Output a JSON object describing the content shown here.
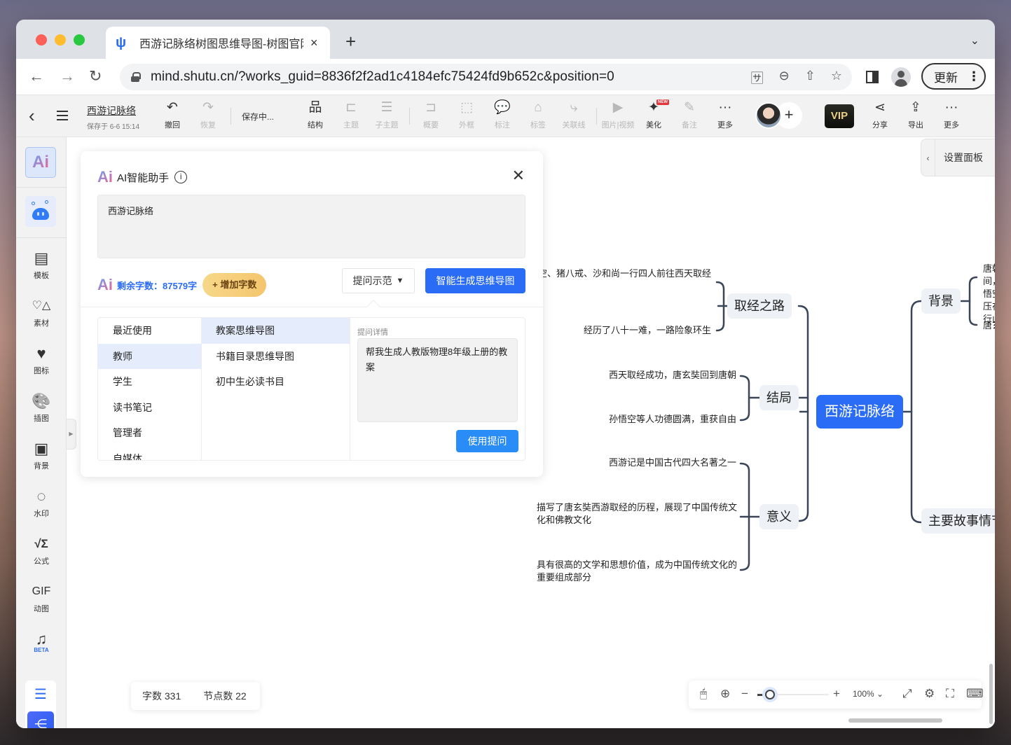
{
  "browser": {
    "tab_title": "西游记脉络树图思维导图-树图官网",
    "tab_favicon": "shutu-logo-icon",
    "new_tab": "+",
    "tab_close": "×",
    "url": "mind.shutu.cn/?works_guid=8836f2f2ad1c4184efc75424fd9b652c&position=0",
    "update_label": "更新",
    "nav": {
      "back": "←",
      "forward": "→",
      "reload": "↻"
    }
  },
  "toolbar": {
    "doc_title": "西游记脉络",
    "saved_at": "保存于 6-6 15:14",
    "saving_status": "保存中...",
    "tools": [
      {
        "id": "undo",
        "label": "撤回",
        "icon": "↶",
        "disabled": false
      },
      {
        "id": "redo",
        "label": "恢复",
        "icon": "↷",
        "disabled": true
      },
      {
        "id": "structure",
        "label": "结构",
        "icon": "品",
        "disabled": false
      },
      {
        "id": "topic",
        "label": "主题",
        "icon": "⊏",
        "disabled": true
      },
      {
        "id": "subtopic",
        "label": "子主题",
        "icon": "☰",
        "disabled": true
      },
      {
        "id": "summary",
        "label": "概要",
        "icon": "⊐",
        "disabled": true
      },
      {
        "id": "boundary",
        "label": "外框",
        "icon": "⬚",
        "disabled": true
      },
      {
        "id": "callout",
        "label": "标注",
        "icon": "💬",
        "disabled": true
      },
      {
        "id": "tag",
        "label": "标签",
        "icon": "⌂",
        "disabled": true
      },
      {
        "id": "relation",
        "label": "关联线",
        "icon": "⤷",
        "disabled": true
      },
      {
        "id": "media",
        "label": "图片|视频",
        "icon": "▶",
        "disabled": true
      },
      {
        "id": "beautify",
        "label": "美化",
        "icon": "✦",
        "disabled": false,
        "badge": "NEW"
      },
      {
        "id": "note",
        "label": "备注",
        "icon": "✎",
        "disabled": true
      },
      {
        "id": "more1",
        "label": "更多",
        "icon": "···",
        "disabled": false
      }
    ],
    "vip_label": "VIP",
    "right_tools": [
      {
        "id": "share",
        "label": "分享",
        "icon": "⋖"
      },
      {
        "id": "export",
        "label": "导出",
        "icon": "⇪"
      },
      {
        "id": "more2",
        "label": "更多",
        "icon": "···"
      }
    ],
    "add_collaborator": "+"
  },
  "sidebar": {
    "ai_label": "Ai",
    "items": [
      {
        "id": "template",
        "label": "模板",
        "icon": "▤"
      },
      {
        "id": "material",
        "label": "素材",
        "icon": "♡△"
      },
      {
        "id": "icon",
        "label": "图标",
        "icon": "♥"
      },
      {
        "id": "illustration",
        "label": "插图",
        "icon": "🎨"
      },
      {
        "id": "background",
        "label": "背景",
        "icon": "▣"
      },
      {
        "id": "watermark",
        "label": "水印",
        "icon": "◌"
      },
      {
        "id": "formula",
        "label": "公式",
        "icon": "√Σ"
      },
      {
        "id": "gif",
        "label": "动图",
        "icon": "GIF"
      },
      {
        "id": "music",
        "label": "",
        "icon": "♫",
        "badge": "BETA"
      }
    ]
  },
  "ai_panel": {
    "title": "AI智能助手",
    "input_value": "西游记脉络",
    "quota_text": "剩余字数：87579字",
    "add_words_label": "+ 增加字数",
    "prompt_demo_label": "提问示范",
    "generate_label": "智能生成思维导图",
    "categories": [
      "最近使用",
      "教师",
      "学生",
      "读书笔记",
      "管理者",
      "自媒体"
    ],
    "active_category": 1,
    "templates": [
      "教案思维导图",
      "书籍目录思维导图",
      "初中生必读书目"
    ],
    "active_template": 0,
    "detail_label": "提问详情",
    "detail_text": "帮我生成人教版物理8年级上册的教案",
    "use_prompt_label": "使用提问"
  },
  "settings_panel_label": "设置面板",
  "mindmap": {
    "root": "西游记脉络",
    "left_branches": [
      {
        "label": "取经之路",
        "children": [
          "唐玄奘、孙悟空、猪八戒、沙和尚一行四人前往西天取经",
          "经历了八十一难，一路险象环生"
        ]
      },
      {
        "label": "结局",
        "children": [
          "西天取经成功，唐玄奘回到唐朝",
          "孙悟空等人功德圆满，重获自由"
        ]
      },
      {
        "label": "意义",
        "children": [
          "西游记是中国古代四大名著之一",
          "描写了唐玄奘西游取经的历程，展现了中国传统文化和佛教文化",
          "具有很高的文学和思想价值，成为中国传统文化的重要组成部分"
        ]
      }
    ],
    "right_branches": [
      {
        "label": "背景",
        "children": [
          "唐朝年间，孙悟空被压在五行山下",
          "唐玄奘"
        ]
      },
      {
        "label": "主要故事情节",
        "children": []
      }
    ]
  },
  "status": {
    "word_count": "字数 331",
    "node_count": "节点数 22"
  },
  "zoom": {
    "level_label": "100%",
    "slider_fraction": 0.18
  }
}
